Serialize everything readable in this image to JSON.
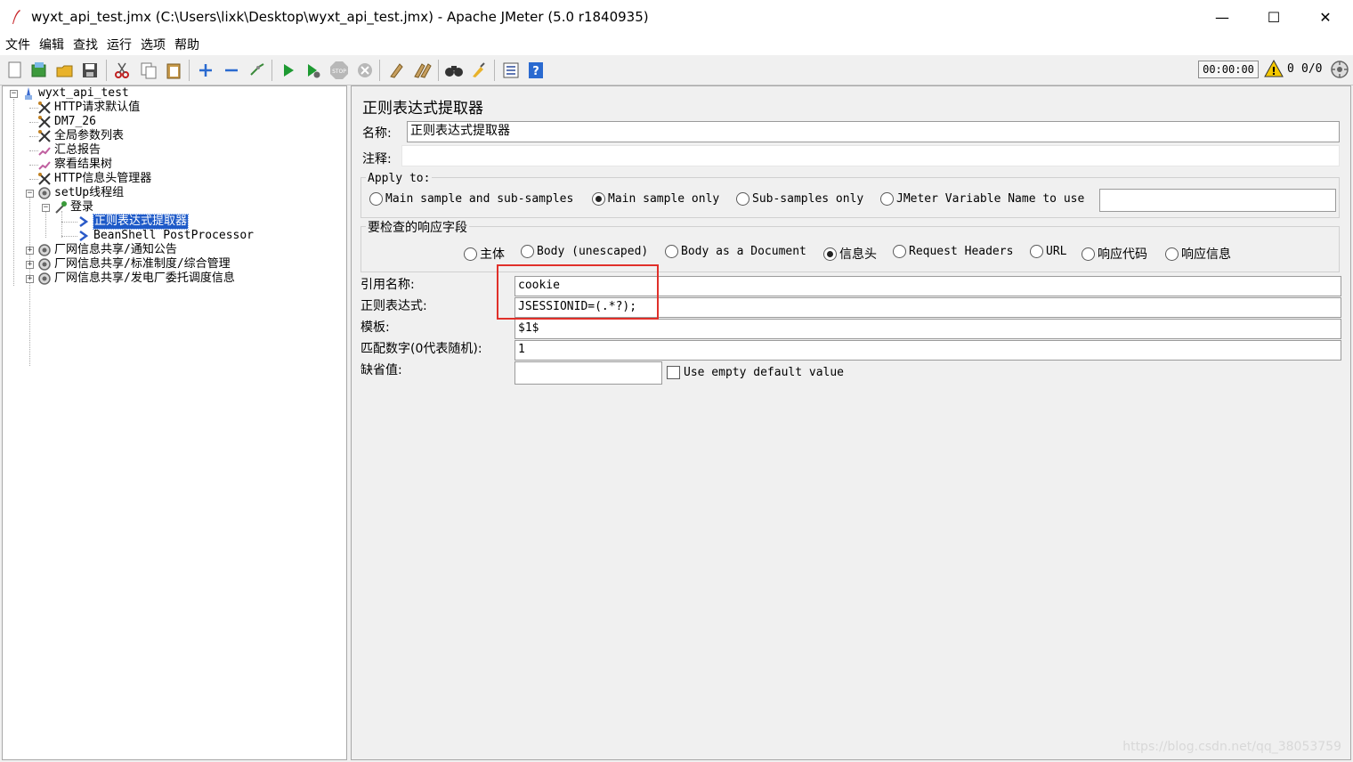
{
  "window": {
    "title": "wyxt_api_test.jmx (C:\\Users\\lixk\\Desktop\\wyxt_api_test.jmx) - Apache JMeter (5.0 r1840935)",
    "minimize": "—",
    "maximize": "☐",
    "close": "✕"
  },
  "menu": [
    "文件",
    "编辑",
    "查找",
    "运行",
    "选项",
    "帮助"
  ],
  "toolbar": {
    "timer": "00:00:00",
    "warning_count": "0",
    "thread_ratio": "0/0"
  },
  "tree": {
    "root": "wyxt_api_test",
    "items": [
      "HTTP请求默认值",
      "DM7_26",
      "全局参数列表",
      "汇总报告",
      "察看结果树",
      "HTTP信息头管理器",
      "setUp线程组",
      "登录",
      "正则表达式提取器",
      "BeanShell PostProcessor",
      "厂网信息共享/通知公告",
      "厂网信息共享/标准制度/综合管理",
      "厂网信息共享/发电厂委托调度信息"
    ]
  },
  "panel": {
    "title": "正则表达式提取器",
    "name_label": "名称:",
    "name_value": "正则表达式提取器",
    "comment_label": "注释:",
    "comment_value": "",
    "apply_to": {
      "title": "Apply to:",
      "options": [
        "Main sample and sub-samples",
        "Main sample only",
        "Sub-samples only",
        "JMeter Variable Name to use"
      ],
      "selected": 1,
      "variable_value": ""
    },
    "field_check": {
      "title": "要检查的响应字段",
      "options": [
        "主体",
        "Body (unescaped)",
        "Body as a Document",
        "信息头",
        "Request Headers",
        "URL",
        "响应代码",
        "响应信息"
      ],
      "selected": 3
    },
    "ref_name_label": "引用名称:",
    "ref_name_value": "cookie",
    "regex_label": "正则表达式:",
    "regex_value": "JSESSIONID=(.*?);",
    "template_label": "模板:",
    "template_value": "$1$",
    "match_label": "匹配数字(0代表随机):",
    "match_value": "1",
    "default_label": "缺省值:",
    "default_value": "",
    "use_empty_label": "Use empty default value"
  },
  "highlight": {
    "color": "#e0302a"
  },
  "watermark": "https://blog.csdn.net/qq_38053759"
}
